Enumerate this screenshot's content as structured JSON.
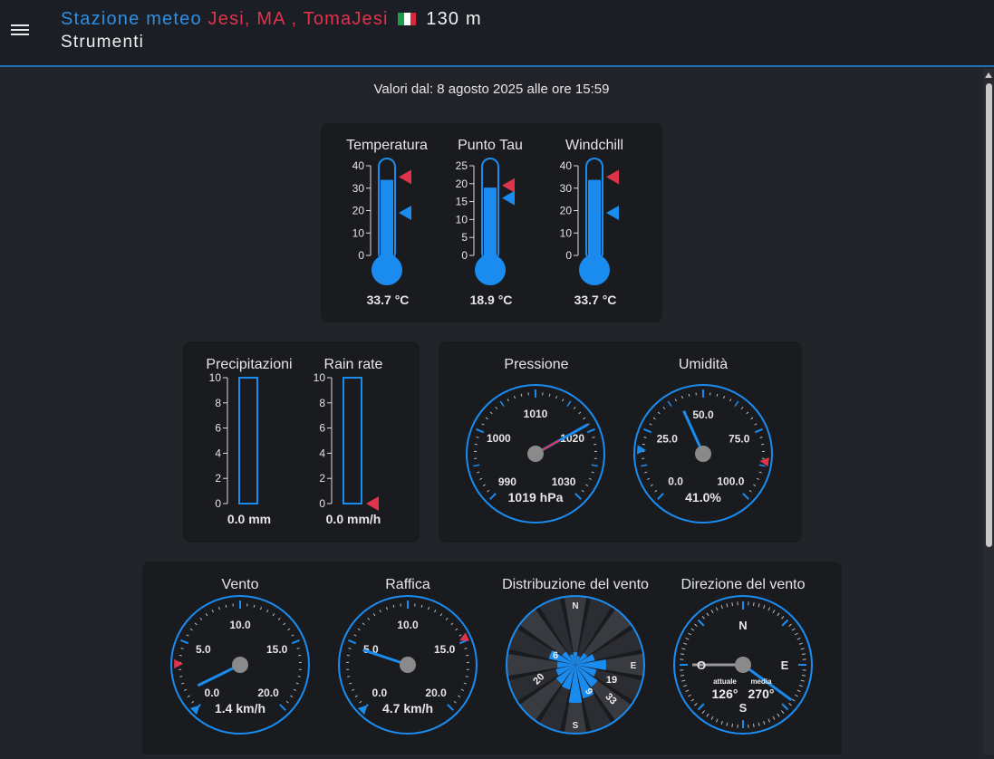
{
  "header": {
    "title_station": "Stazione meteo",
    "title_place": "Jesi, MA , TomaJesi",
    "title_altitude": "130 m",
    "subtitle": "Strumenti"
  },
  "since_text": "Valori dal: 8 agosto 2025 alle ore 15:59",
  "colors": {
    "accent": "#1a8cf0",
    "marker_high": "#e0334c",
    "marker_low": "#1a8cf0",
    "panel": "#1a1b1f",
    "background": "#232429"
  },
  "icons": {
    "menu": "menu-icon",
    "flag": "italy-flag-icon"
  },
  "thermometers": [
    {
      "title": "Temperatura",
      "ticks": [
        "40",
        "30",
        "20",
        "10",
        "0"
      ],
      "value": 33.7,
      "max_scale": 40,
      "high": 35,
      "low": 19,
      "value_text": "33.7 °C"
    },
    {
      "title": "Punto Tau",
      "ticks": [
        "25",
        "20",
        "15",
        "10",
        "5",
        "0"
      ],
      "value": 18.9,
      "max_scale": 25,
      "high": 19.5,
      "low": 16,
      "value_text": "18.9 °C"
    },
    {
      "title": "Windchill",
      "ticks": [
        "40",
        "30",
        "20",
        "10",
        "0"
      ],
      "value": 33.7,
      "max_scale": 40,
      "high": 35,
      "low": 19,
      "value_text": "33.7 °C"
    }
  ],
  "bars": [
    {
      "title": "Precipitazioni",
      "ticks": [
        "10",
        "8",
        "6",
        "4",
        "2",
        "0"
      ],
      "value": 0.0,
      "value_text": "0.0 mm",
      "has_marker": false
    },
    {
      "title": "Rain rate",
      "ticks": [
        "10",
        "8",
        "6",
        "4",
        "2",
        "0"
      ],
      "value": 0.0,
      "value_text": "0.0 mm/h",
      "has_marker": true
    }
  ],
  "pressure": {
    "title": "Pressione",
    "labels": [
      "990",
      "1000",
      "1010",
      "1020",
      "1030"
    ],
    "value": 1019,
    "value_text": "1019 hPa"
  },
  "humidity": {
    "title": "Umidità",
    "labels": [
      "0.0",
      "25.0",
      "50.0",
      "75.0",
      "100.0"
    ],
    "value": 41.0,
    "value_text": "41.0%"
  },
  "wind": {
    "title": "Vento",
    "labels": [
      "0.0",
      "5.0",
      "10.0",
      "15.0",
      "20.0"
    ],
    "value": 1.4,
    "value_text": "1.4 km/h"
  },
  "gust": {
    "title": "Raffica",
    "labels": [
      "0.0",
      "5.0",
      "10.0",
      "15.0",
      "20.0"
    ],
    "value": 4.7,
    "value_text": "4.7 km/h"
  },
  "wind_distribution": {
    "title": "Distribuzione del vento",
    "cardinals": [
      "N",
      "E",
      "S"
    ],
    "labels": [
      "6",
      "20",
      "19",
      "9",
      "33"
    ]
  },
  "wind_direction": {
    "title": "Direzione del vento",
    "cardinals": [
      "N",
      "E",
      "S",
      "O"
    ],
    "current_label": "attuale",
    "current_value": "126°",
    "mean_label": "media",
    "mean_value": "270°",
    "current_deg": 126,
    "mean_deg": 270
  }
}
